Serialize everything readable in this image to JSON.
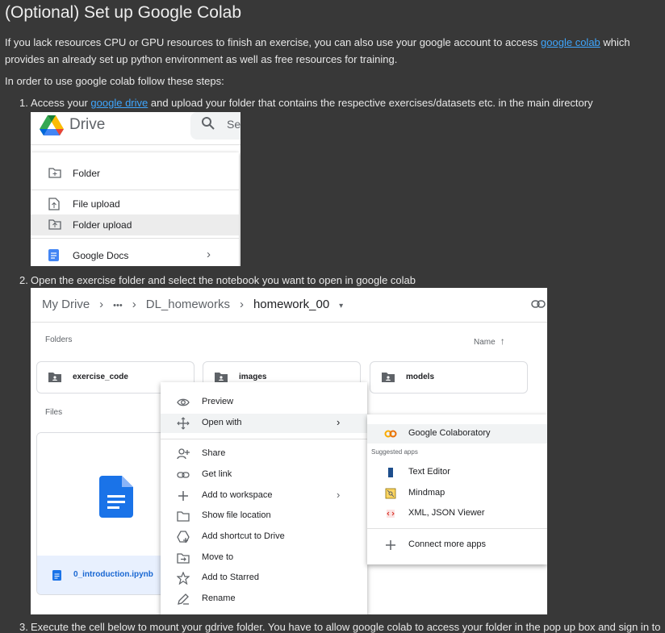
{
  "heading": "(Optional) Set up Google Colab",
  "intro": {
    "before": "If you lack resources CPU or GPU resources to finish an exercise, you can also use your google account to access ",
    "link": "google colab",
    "after": " which provides an already set up python environment as well as free resources for training."
  },
  "steps_intro": "In order to use google colab follow these steps:",
  "step1": {
    "num": "1.",
    "before": "Access your ",
    "link": "google drive",
    "after": " and upload your folder that contains the respective exercises/datasets etc. in the main directory"
  },
  "step2": {
    "num": "2.",
    "text": "Open the exercise folder and select the notebook you want to open in google colab"
  },
  "step3": {
    "num": "3.",
    "text": "Execute the cell below to mount your gdrive folder. You have to allow google colab to access your folder in the pop up box and sign in to"
  },
  "shot1": {
    "app_name": "Drive",
    "search_text": "Sea",
    "menu": [
      "Folder",
      "File upload",
      "Folder upload",
      "Google Docs"
    ],
    "chevron": "›"
  },
  "shot2": {
    "breadcrumb": [
      "My Drive",
      "›",
      "•••",
      "›",
      "DL_homeworks",
      "›",
      "homework_00"
    ],
    "folders_label": "Folders",
    "sort_label": "Name",
    "files_label": "Files",
    "folders": [
      "exercise_code",
      "images",
      "models"
    ],
    "file_name": "0_introduction.ipynb",
    "context_menu": [
      "Preview",
      "Open with",
      "Share",
      "Get link",
      "Add to workspace",
      "Show file location",
      "Add shortcut to Drive",
      "Move to",
      "Add to Starred",
      "Rename"
    ],
    "open_with": {
      "highlight": "Google Colaboratory",
      "suggested_label": "Suggested apps",
      "apps": [
        "Text Editor",
        "Mindmap",
        "XML, JSON Viewer"
      ],
      "connect": "Connect more apps"
    }
  },
  "colors": {
    "page_bg": "#383838",
    "link": "#3ea6ff",
    "drive_blue": "#1a73e8",
    "hover": "#f1f3f4"
  }
}
